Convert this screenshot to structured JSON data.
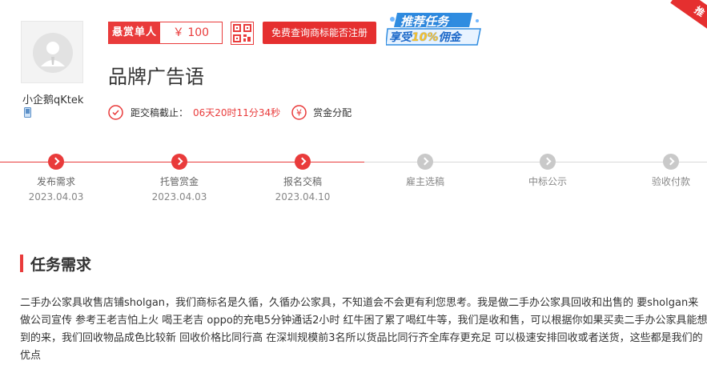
{
  "user": {
    "name": "小企鹅qKtek",
    "avatar_icon": "default-avatar-icon",
    "phone_icon": "mobile-phone-icon"
  },
  "bounty": {
    "label": "悬赏单人",
    "amount": "￥ 100"
  },
  "query_button": "免费查询商标能否注册",
  "promo": {
    "line1": "推荐任务",
    "line2_prefix": "享受",
    "line2_highlight": "10%",
    "line2_suffix": "佣金"
  },
  "corner_ribbon": "推",
  "task": {
    "title": "品牌广告语",
    "deadline_label": "距交稿截止：",
    "deadline_time": "06天20时11分34秒",
    "reward_mode": "赏金分配"
  },
  "timeline": {
    "steps": [
      {
        "label": "发布需求",
        "date": "2023.04.03",
        "status": "done"
      },
      {
        "label": "托管赏金",
        "date": "2023.04.03",
        "status": "done"
      },
      {
        "label": "报名交稿",
        "date": "2023.04.10",
        "status": "done"
      },
      {
        "label": "雇主选稿",
        "date": "",
        "status": "pending"
      },
      {
        "label": "中标公示",
        "date": "",
        "status": "pending"
      },
      {
        "label": "验收付款",
        "date": "",
        "status": "pending"
      }
    ]
  },
  "section": {
    "title": "任务需求",
    "description": "二手办公家具收售店铺sholgan，我们商标名是久循，久循办公家具，不知道会不会更有利您思考。我是做二手办公家具回收和出售的 要sholgan来做公司宣传 参考王老吉怕上火 喝王老吉 oppo的充电5分钟通话2小时 红牛困了累了喝红牛等，我们是收和售，可以根据你如果买卖二手办公家具能想到的来，我们回收物品成色比较新 回收价格比同行高 在深圳规模前3名所以货品比同行齐全库存更充足 可以极速安排回收或者送货，这些都是我们的优点"
  },
  "colors": {
    "accent": "#e93b3b",
    "pending": "#c9c9c9"
  }
}
